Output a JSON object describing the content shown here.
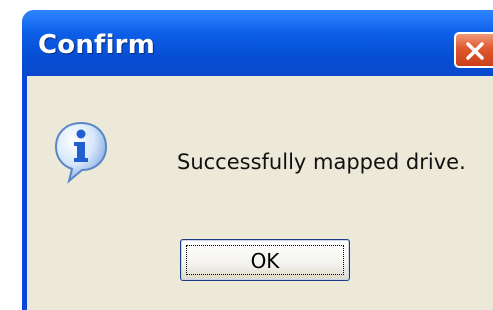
{
  "dialog": {
    "title": "Confirm",
    "message": "Successfully mapped drive.",
    "ok_label": "OK",
    "icon": "info-icon",
    "close_icon": "close-icon"
  },
  "colors": {
    "titlebar": "#0a49cc",
    "client_background": "#ece9d8",
    "close_button": "#e0582f",
    "info_icon": "#2f6fd8"
  }
}
